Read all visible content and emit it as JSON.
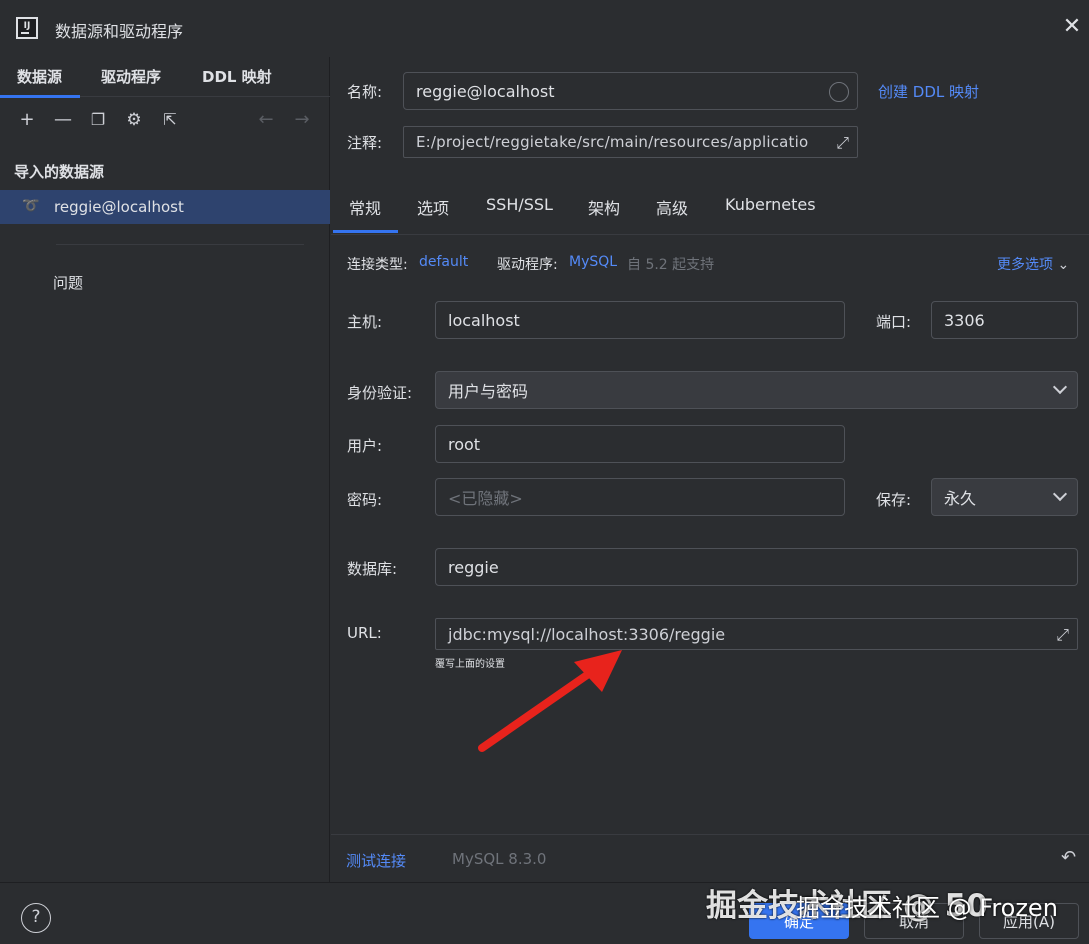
{
  "window": {
    "title": "数据源和驱动程序"
  },
  "left": {
    "tabs": [
      "数据源",
      "驱动程序",
      "DDL 映射"
    ],
    "section_title": "导入的数据源",
    "datasource": "reggie@localhost",
    "issues_label": "问题"
  },
  "form": {
    "name_label": "名称:",
    "name_value": "reggie@localhost",
    "create_ddl_link": "创建 DDL 映射",
    "comment_label": "注释:",
    "comment_value": "E:/project/reggietake/src/main/resources/applicatio"
  },
  "tabs": [
    "常规",
    "选项",
    "SSH/SSL",
    "架构",
    "高级",
    "Kubernetes"
  ],
  "general": {
    "conn_type_label": "连接类型:",
    "conn_type_value": "default",
    "driver_label": "驱动程序:",
    "driver_value": "MySQL",
    "driver_note": "自 5.2 起支持",
    "more_options": "更多选项",
    "host_label": "主机:",
    "host_value": "localhost",
    "port_label": "端口:",
    "port_value": "3306",
    "auth_label": "身份验证:",
    "auth_value": "用户与密码",
    "user_label": "用户:",
    "user_value": "root",
    "password_label": "密码:",
    "password_placeholder": "<已隐藏>",
    "save_label": "保存:",
    "save_value": "永久",
    "database_label": "数据库:",
    "database_value": "reggie",
    "url_label": "URL:",
    "url_value": "jdbc:mysql://localhost:3306/reggie",
    "url_hint": "覆写上面的设置"
  },
  "bottom": {
    "test_connection": "测试连接",
    "mysql_version": "MySQL 8.3.0"
  },
  "footer": {
    "ok": "确定",
    "cancel": "取消",
    "apply": "应用(A)"
  },
  "watermark": {
    "text1": "掘金技术社区 @ 50",
    "text2": "掘金技术社区 @ Frozen"
  }
}
